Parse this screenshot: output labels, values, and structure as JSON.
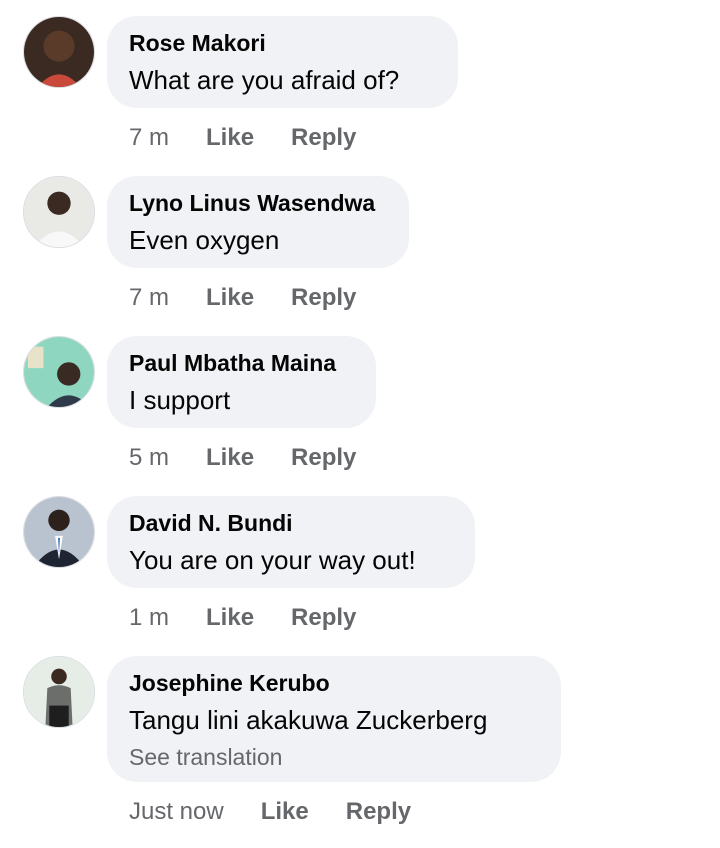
{
  "comments": [
    {
      "author": "Rose Makori",
      "text": "What are you afraid of?",
      "time": "7 m",
      "like_label": "Like",
      "reply_label": "Reply"
    },
    {
      "author": "Lyno Linus Wasendwa",
      "text": "Even oxygen",
      "time": "7 m",
      "like_label": "Like",
      "reply_label": "Reply"
    },
    {
      "author": "Paul Mbatha Maina",
      "text": "I support",
      "time": "5 m",
      "like_label": "Like",
      "reply_label": "Reply"
    },
    {
      "author": "David N. Bundi",
      "text": "You are on your way out!",
      "time": "1 m",
      "like_label": "Like",
      "reply_label": "Reply"
    },
    {
      "author": "Josephine Kerubo",
      "text": "Tangu lini akakuwa Zuckerberg",
      "see_translation": "See translation",
      "time": "Just now",
      "like_label": "Like",
      "reply_label": "Reply"
    }
  ],
  "colors": {
    "bubble": "#f0f2f5",
    "secondary_text": "#65676b",
    "primary_text": "#050505"
  },
  "icons": [
    "avatar-photo"
  ]
}
